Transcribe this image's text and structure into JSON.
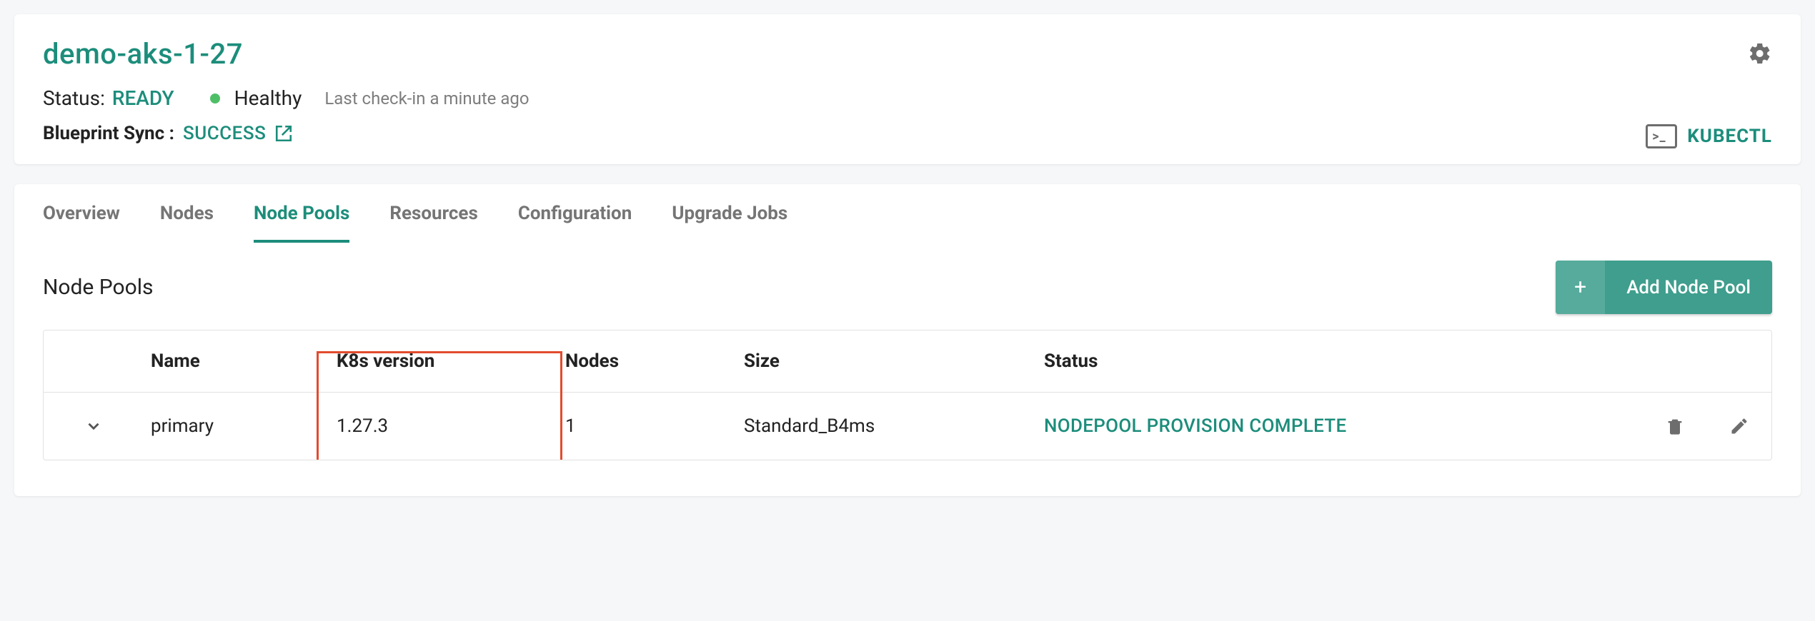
{
  "header": {
    "title": "demo-aks-1-27",
    "status_label": "Status:",
    "status_value": "READY",
    "health_text": "Healthy",
    "checkin": "Last check-in a minute ago",
    "blueprint_label": "Blueprint Sync :",
    "blueprint_value": "SUCCESS",
    "kubectl": "KUBECTL"
  },
  "tabs": [
    {
      "label": "Overview"
    },
    {
      "label": "Nodes"
    },
    {
      "label": "Node Pools"
    },
    {
      "label": "Resources"
    },
    {
      "label": "Configuration"
    },
    {
      "label": "Upgrade Jobs"
    }
  ],
  "active_tab_index": 2,
  "section": {
    "title": "Node Pools",
    "add_label": "Add Node Pool",
    "add_plus": "+"
  },
  "table": {
    "columns": [
      "Name",
      "K8s version",
      "Nodes",
      "Size",
      "Status"
    ],
    "rows": [
      {
        "name": "primary",
        "k8s_version": "1.27.3",
        "nodes": "1",
        "size": "Standard_B4ms",
        "status": "NODEPOOL PROVISION COMPLETE"
      }
    ]
  },
  "highlight_column": "K8s version"
}
